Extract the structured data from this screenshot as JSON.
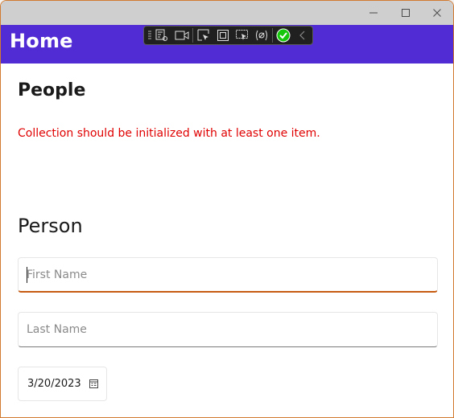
{
  "header": {
    "title": "Home"
  },
  "section_people": {
    "title": "People",
    "error": "Collection should be initialized with at least one item."
  },
  "section_person": {
    "title": "Person",
    "first_name": {
      "value": "",
      "placeholder": "First Name"
    },
    "last_name": {
      "value": "",
      "placeholder": "Last Name"
    },
    "date": {
      "value": "3/20/2023"
    }
  },
  "devbar": {
    "tools": [
      "live-visual-tree-icon",
      "record-icon",
      "select-element-icon",
      "display-layout-adorners-icon",
      "track-focus-icon",
      "binding-failures-icon",
      "hot-reload-check-icon",
      "collapse-icon"
    ]
  },
  "colors": {
    "header_bg": "#512bd4",
    "error": "#e00000",
    "focus_underline": "#c75b12",
    "window_border": "#d27a30",
    "hot_reload_ok": "#16c60c"
  }
}
